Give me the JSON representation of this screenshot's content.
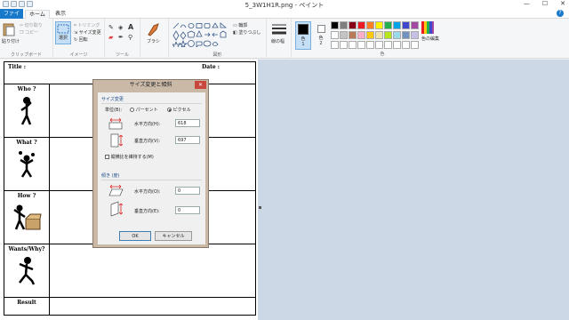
{
  "window": {
    "title": "5_3W1H1R.png - ペイント",
    "minimize": "—",
    "maximize": "☐",
    "close": "✕"
  },
  "tabs": {
    "file": "ファイル",
    "home": "ホーム",
    "view": "表示"
  },
  "ribbon": {
    "clipboard": {
      "paste": "貼り付け",
      "cut": "切り取り",
      "copy": "コピー",
      "label": "クリップボード"
    },
    "image": {
      "select": "選択",
      "crop": "トリミング",
      "resize": "サイズ変更",
      "rotate": "回転",
      "label": "イメージ"
    },
    "tools": {
      "label": "ツール"
    },
    "brush": {
      "label": "ブラシ"
    },
    "shapes": {
      "outline": "輪郭",
      "fill": "塗りつぶし",
      "label": "図形"
    },
    "size": {
      "label": "線の幅"
    },
    "color1": {
      "label": "色",
      "sub": "1"
    },
    "color2": {
      "label": "色",
      "sub": "2"
    },
    "colors": {
      "label": "色",
      "edit": "色の編集"
    }
  },
  "palette_row1": [
    "#000000",
    "#7f7f7f",
    "#880015",
    "#ed1c24",
    "#ff7f27",
    "#fff200",
    "#22b14c",
    "#00a2e8",
    "#3f48cc",
    "#a349a4"
  ],
  "palette_row2": [
    "#ffffff",
    "#c3c3c3",
    "#b97a57",
    "#ffaec9",
    "#ffc90e",
    "#efe4b0",
    "#b5e61d",
    "#99d9ea",
    "#7092be",
    "#c8bfe7"
  ],
  "document": {
    "title_label": "Title :",
    "date_label": "Date :",
    "rows": [
      "Who ?",
      "What ?",
      "How ?",
      "Wants/Why?",
      "Result"
    ]
  },
  "dialog": {
    "title": "サイズ変更と傾斜",
    "close": "✕",
    "resize_section": "サイズ変更",
    "unit_label": "単位(B):",
    "percent": "パーセント",
    "pixels": "ピクセル",
    "horizontal_label": "水平方向(H):",
    "horizontal_value": "618",
    "vertical_label": "垂直方向(V):",
    "vertical_value": "697",
    "keep_ratio": "縦横比を維持する(M)",
    "skew_section": "傾き (度)",
    "skew_h_label": "水平方向(O):",
    "skew_h_value": "0",
    "skew_v_label": "垂直方向(E):",
    "skew_v_value": "0",
    "ok": "OK",
    "cancel": "キャンセル"
  }
}
